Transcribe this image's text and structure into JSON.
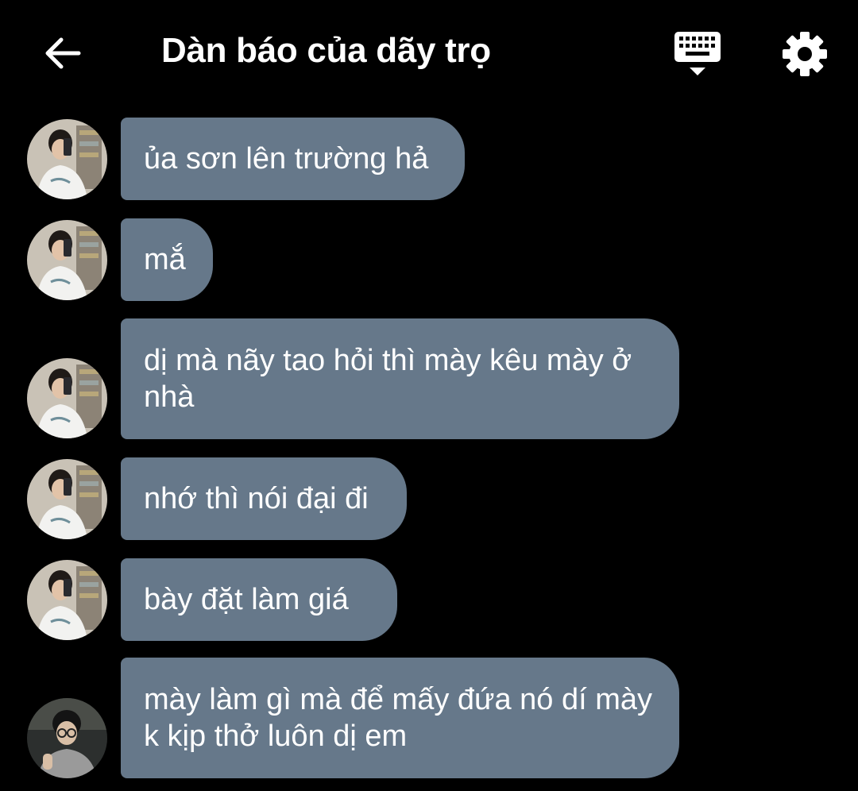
{
  "header": {
    "title": "Dàn báo của dãy trọ",
    "back_icon": "arrow-left-icon",
    "keyboard_icon": "keyboard-icon",
    "settings_icon": "gear-icon"
  },
  "colors": {
    "background": "#000000",
    "bubble": "#66788a",
    "text": "#ffffff"
  },
  "messages": [
    {
      "sender": "user-a",
      "text": "ủa sơn lên trường hả"
    },
    {
      "sender": "user-a",
      "text": "mắ"
    },
    {
      "sender": "user-a",
      "text": "dị mà nãy tao hỏi thì mày kêu mày ở nhà"
    },
    {
      "sender": "user-a",
      "text": "nhớ thì nói đại đi"
    },
    {
      "sender": "user-a",
      "text": "bày đặt làm giá"
    },
    {
      "sender": "user-b",
      "text": "mày làm gì mà để mấy đứa nó dí mày k kịp thở luôn dị em"
    }
  ]
}
